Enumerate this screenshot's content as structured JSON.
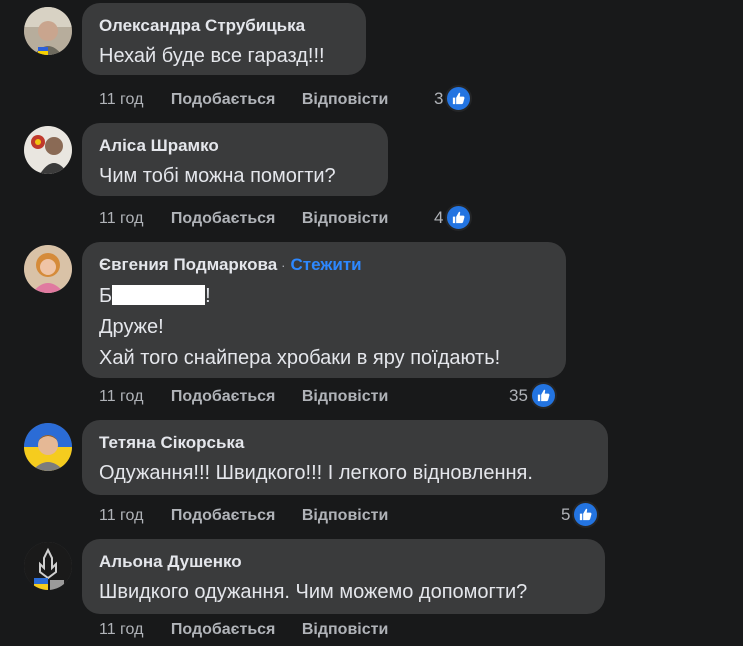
{
  "comments": [
    {
      "author": "Олександра Струбицька",
      "text_lines": [
        "Нехай буде все гаразд!!!"
      ],
      "time": "11 год",
      "like_label": "Подобається",
      "reply_label": "Відповісти",
      "reaction_count": "3"
    },
    {
      "author": "Аліса Шрамко",
      "text_lines": [
        "Чим тобі можна помогти?"
      ],
      "time": "11 год",
      "like_label": "Подобається",
      "reply_label": "Відповісти",
      "reaction_count": "4"
    },
    {
      "author": "Євгения Подмаркова",
      "follow_label": "Стежити",
      "text_prefix": "Б",
      "text_suffix": "!",
      "text_lines": [
        "Друже!",
        "Хай того снайпера хробаки в яру поїдають!"
      ],
      "time": "11 год",
      "like_label": "Подобається",
      "reply_label": "Відповісти",
      "reaction_count": "35"
    },
    {
      "author": "Тетяна Сікорська",
      "text_lines": [
        "Одужання!!! Швидкого!!! І легкого відновлення."
      ],
      "time": "11 год",
      "like_label": "Подобається",
      "reply_label": "Відповісти",
      "reaction_count": "5"
    },
    {
      "author": "Альона Душенко",
      "text_lines": [
        "Швидкого одужання. Чим можемо допомогти?"
      ],
      "time": "11 год",
      "like_label": "Подобається",
      "reply_label": "Відповісти"
    }
  ],
  "colors": {
    "background": "#18191a",
    "bubble": "#3a3b3c",
    "text": "#e4e6eb",
    "secondary": "#b0b3b8",
    "link": "#2d88ff",
    "like": "#2374e1"
  }
}
